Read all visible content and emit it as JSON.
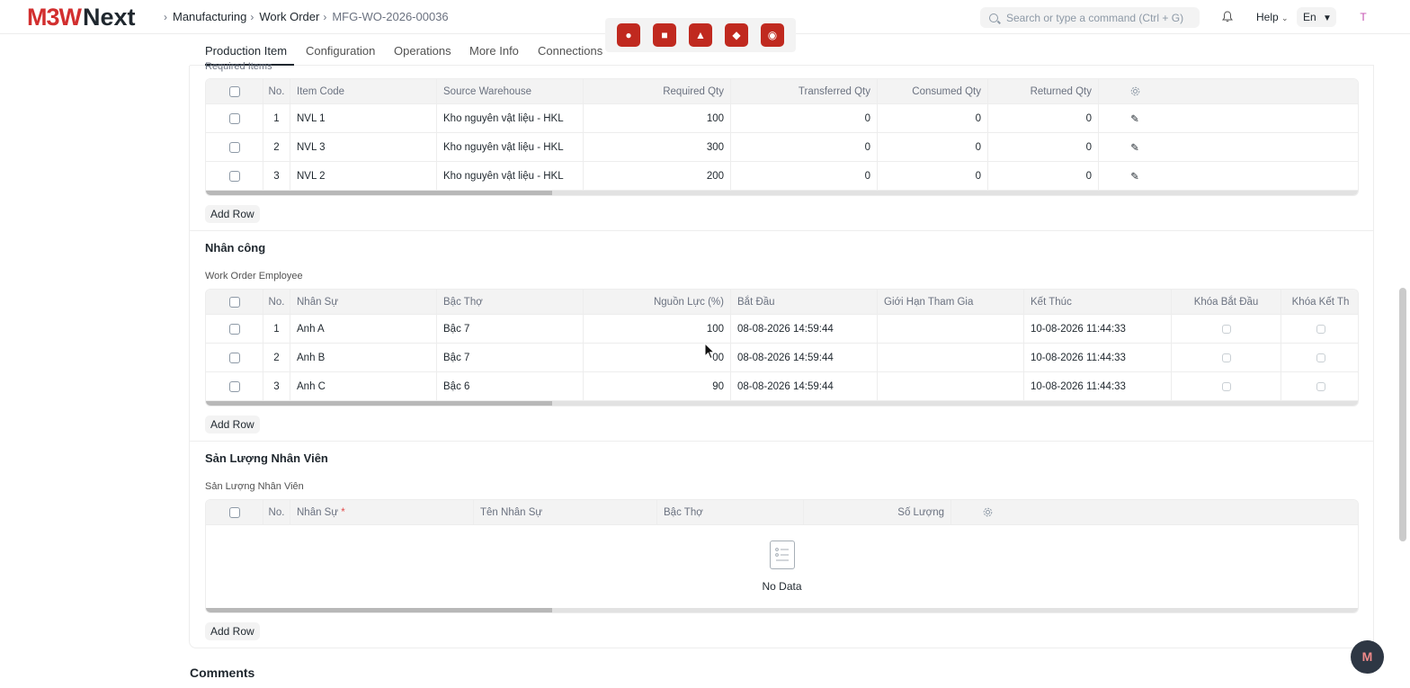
{
  "navbar": {
    "logo_main": "M3W",
    "logo_next": "Next",
    "breadcrumbs": [
      "Manufacturing",
      "Work Order",
      "MFG-WO-2026-00036"
    ],
    "search_placeholder": "Search or type a command (Ctrl + G)",
    "help_label": "Help",
    "lang_label": "En",
    "user_initial": "T"
  },
  "tabs": [
    "Production Item",
    "Configuration",
    "Operations",
    "More Info",
    "Connections"
  ],
  "required_items": {
    "section_label": "Required Items",
    "columns": [
      "No.",
      "Item Code",
      "Source Warehouse",
      "Required Qty",
      "Transferred Qty",
      "Consumed Qty",
      "Returned Qty"
    ],
    "rows": [
      {
        "no": "1",
        "item_code": "NVL 1",
        "warehouse": "Kho nguyên vật liệu - HKL",
        "required": "100",
        "transferred": "0",
        "consumed": "0",
        "returned": "0"
      },
      {
        "no": "2",
        "item_code": "NVL 3",
        "warehouse": "Kho nguyên vật liệu - HKL",
        "required": "300",
        "transferred": "0",
        "consumed": "0",
        "returned": "0"
      },
      {
        "no": "3",
        "item_code": "NVL 2",
        "warehouse": "Kho nguyên vật liệu - HKL",
        "required": "200",
        "transferred": "0",
        "consumed": "0",
        "returned": "0"
      }
    ],
    "add_row": "Add Row"
  },
  "labor": {
    "title": "Nhân công",
    "field_label": "Work Order Employee",
    "columns": [
      "No.",
      "Nhân Sự",
      "Bậc Thợ",
      "Nguồn Lực (%)",
      "Bắt Đầu",
      "Giới Hạn Tham Gia",
      "Kết Thúc",
      "Khóa Bắt Đầu",
      "Khóa Kết Th"
    ],
    "rows": [
      {
        "no": "1",
        "employee": "Anh A",
        "grade": "Bậc 7",
        "resource": "100",
        "start": "08-08-2026 14:59:44",
        "limit": "",
        "end": "10-08-2026 11:44:33"
      },
      {
        "no": "2",
        "employee": "Anh B",
        "grade": "Bậc 7",
        "resource": "00",
        "start": "08-08-2026 14:59:44",
        "limit": "",
        "end": "10-08-2026 11:44:33"
      },
      {
        "no": "3",
        "employee": "Anh C",
        "grade": "Bậc 6",
        "resource": "90",
        "start": "08-08-2026 14:59:44",
        "limit": "",
        "end": "10-08-2026 11:44:33"
      }
    ],
    "add_row": "Add Row"
  },
  "output": {
    "title": "Sản Lượng Nhân Viên",
    "field_label": "Sản Lượng Nhân Viên",
    "columns": [
      "No.",
      "Nhân Sự",
      "Tên Nhân Sự",
      "Bậc Thợ",
      "Số Lượng"
    ],
    "required_mark": "*",
    "empty_text": "No Data",
    "add_row": "Add Row"
  },
  "comments_title": "Comments",
  "fab_label": "M",
  "icons": [
    "search-icon",
    "bell-icon",
    "chevron-down-icon",
    "gear-icon",
    "edit-pencil-icon",
    "empty-list-icon"
  ],
  "colors": {
    "brand": "#d22f2f",
    "tool": "#c0291f",
    "fab": "#2e3744"
  }
}
